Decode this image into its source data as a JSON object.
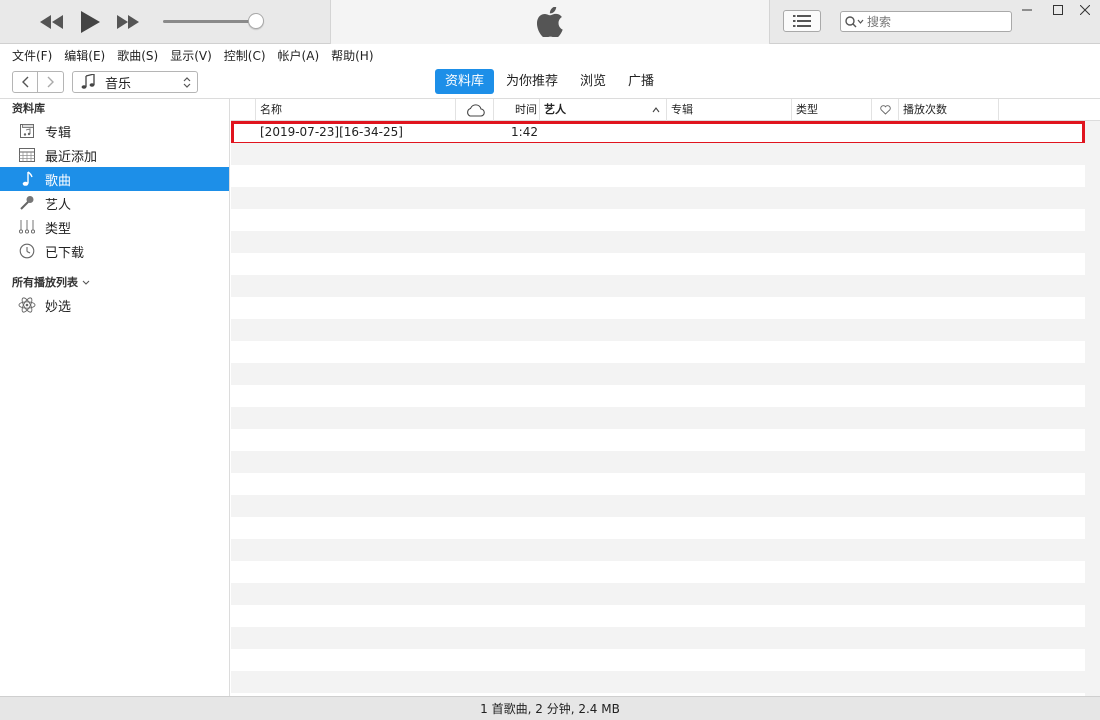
{
  "player": {
    "previous_icon": "rewind-icon",
    "play_icon": "play-icon",
    "next_icon": "fast-forward-icon",
    "volume_percent": 90,
    "brand_icon": "apple-logo-icon"
  },
  "search": {
    "placeholder": "搜索"
  },
  "menu": [
    "文件(F)",
    "编辑(E)",
    "歌曲(S)",
    "显示(V)",
    "控制(C)",
    "帐户(A)",
    "帮助(H)"
  ],
  "nav": {
    "media_type": "音乐",
    "tabs": [
      "资料库",
      "为你推荐",
      "浏览",
      "广播"
    ],
    "active_tab": 0
  },
  "sidebar": {
    "library_title": "资料库",
    "library_items": [
      {
        "label": "专辑",
        "icon": "album-icon"
      },
      {
        "label": "最近添加",
        "icon": "calendar-grid-icon"
      },
      {
        "label": "歌曲",
        "icon": "music-note-icon",
        "active": true
      },
      {
        "label": "艺人",
        "icon": "microphone-icon"
      },
      {
        "label": "类型",
        "icon": "genre-icon"
      },
      {
        "label": "已下载",
        "icon": "download-clock-icon"
      }
    ],
    "playlists_title": "所有播放列表",
    "playlist_items": [
      {
        "label": "妙选",
        "icon": "genius-atom-icon"
      }
    ]
  },
  "table": {
    "headers": {
      "name": "名称",
      "time": "时间",
      "artist": "艺人",
      "album": "专辑",
      "genre": "类型",
      "plays": "播放次数"
    },
    "rows": [
      {
        "name": "[2019-07-23][16-34-25]",
        "time": "1:42",
        "artist": "",
        "album": "",
        "genre": ""
      }
    ]
  },
  "status": "1 首歌曲, 2 分钟, 2.4 MB",
  "colors": {
    "accent": "#1d8fe8",
    "highlight_box": "#e0141e"
  }
}
